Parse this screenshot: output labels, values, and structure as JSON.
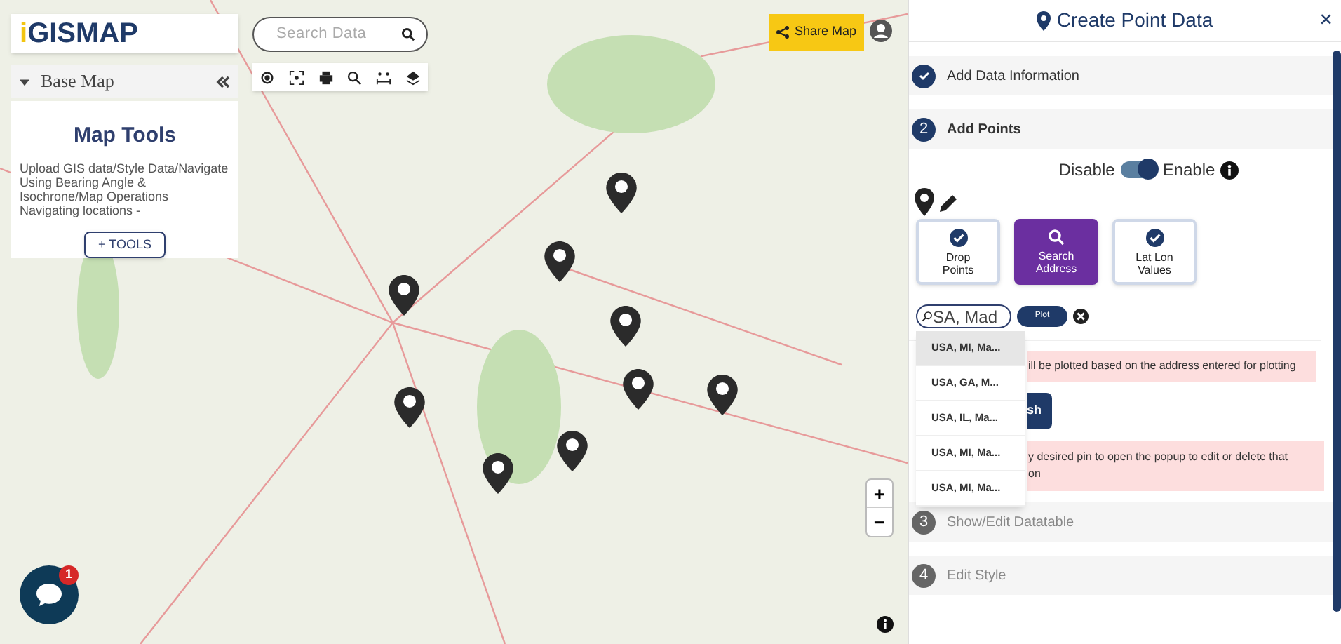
{
  "logo": {
    "text": "GISMAP",
    "prefix": "i"
  },
  "search": {
    "placeholder": "Search Data"
  },
  "base_map": {
    "label": "Base Map",
    "expanded": true
  },
  "map_tools": {
    "title": "Map Tools",
    "description": "Upload GIS data/Style Data/Navigate Using Bearing Angle & Isochrone/Map Operations Navigating locations -",
    "button": "+ TOOLS"
  },
  "share_button": "Share Map",
  "chat": {
    "badge": "1"
  },
  "zoom": {
    "in": "+",
    "out": "−"
  },
  "panel": {
    "title": "Create Point Data",
    "close": "×",
    "steps": [
      {
        "label": "Add Data Information",
        "done": true,
        "expanded": false
      },
      {
        "number": "2",
        "label": "Add Points",
        "done": false,
        "expanded": true
      },
      {
        "number": "3",
        "label": "Show/Edit Datatable",
        "done": false,
        "expanded": false
      },
      {
        "number": "4",
        "label": "Edit Style",
        "done": false,
        "expanded": false
      }
    ],
    "toggle": {
      "off_label": "Disable",
      "on_label": "Enable",
      "on": true
    },
    "modes": [
      {
        "label": "Drop Points",
        "selected": false
      },
      {
        "label": "Search Address",
        "selected": true
      },
      {
        "label": "Lat Lon Values",
        "selected": false
      }
    ],
    "address_input": {
      "value": "SA, Mad"
    },
    "plot_button": "Plot",
    "suggestions": [
      {
        "label": "USA, MI, Ma...",
        "selected": true
      },
      {
        "label": "USA, GA, M...",
        "selected": false
      },
      {
        "label": "USA, IL, Ma...",
        "selected": false
      },
      {
        "label": "USA, MI, Ma...",
        "selected": false
      },
      {
        "label": "USA, MI, Ma...",
        "selected": false
      }
    ],
    "note_1": "ill be plotted based on the address entered for plotting",
    "action_button": "sh",
    "note_2": "y desired pin to open the popup to edit or delete that on"
  }
}
